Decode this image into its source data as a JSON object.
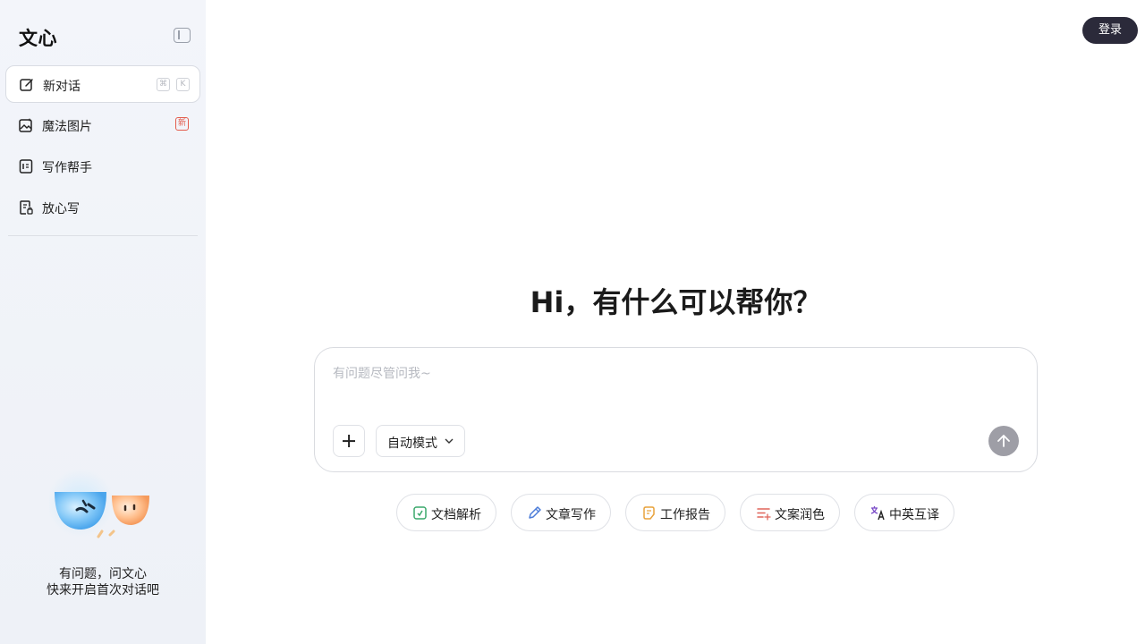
{
  "sidebar": {
    "logo": "文心",
    "items": [
      {
        "label": "新对话",
        "icon": "new-chat-icon",
        "shortcut": [
          "⌘",
          "K"
        ]
      },
      {
        "label": "魔法图片",
        "icon": "magic-image-icon",
        "badge": "新"
      },
      {
        "label": "写作帮手",
        "icon": "writing-helper-icon"
      },
      {
        "label": "放心写",
        "icon": "secure-write-icon"
      }
    ],
    "promo": {
      "line1": "有问题，问文心",
      "line2": "快来开启首次对话吧"
    }
  },
  "header": {
    "login_label": "登录"
  },
  "main": {
    "greeting": "Hi，有什么可以帮你？",
    "input": {
      "placeholder": "有问题尽管问我~",
      "value": ""
    },
    "mode": {
      "selected": "自动模式"
    },
    "chips": [
      {
        "label": "文档解析",
        "icon": "document-parse-icon",
        "color": "#3aa86b"
      },
      {
        "label": "文章写作",
        "icon": "pen-icon",
        "color": "#4a7bd8"
      },
      {
        "label": "工作报告",
        "icon": "report-icon",
        "color": "#e8a23c"
      },
      {
        "label": "文案润色",
        "icon": "polish-icon",
        "color": "#e0655a"
      },
      {
        "label": "中英互译",
        "icon": "translate-icon",
        "color": "#7a4bc8"
      }
    ]
  },
  "colors": {
    "sidebar_bg": "#f3f5fa",
    "login_bg": "#2b2a3a",
    "send_button": "#9e9ea6",
    "badge_red": "#e35b4d"
  }
}
